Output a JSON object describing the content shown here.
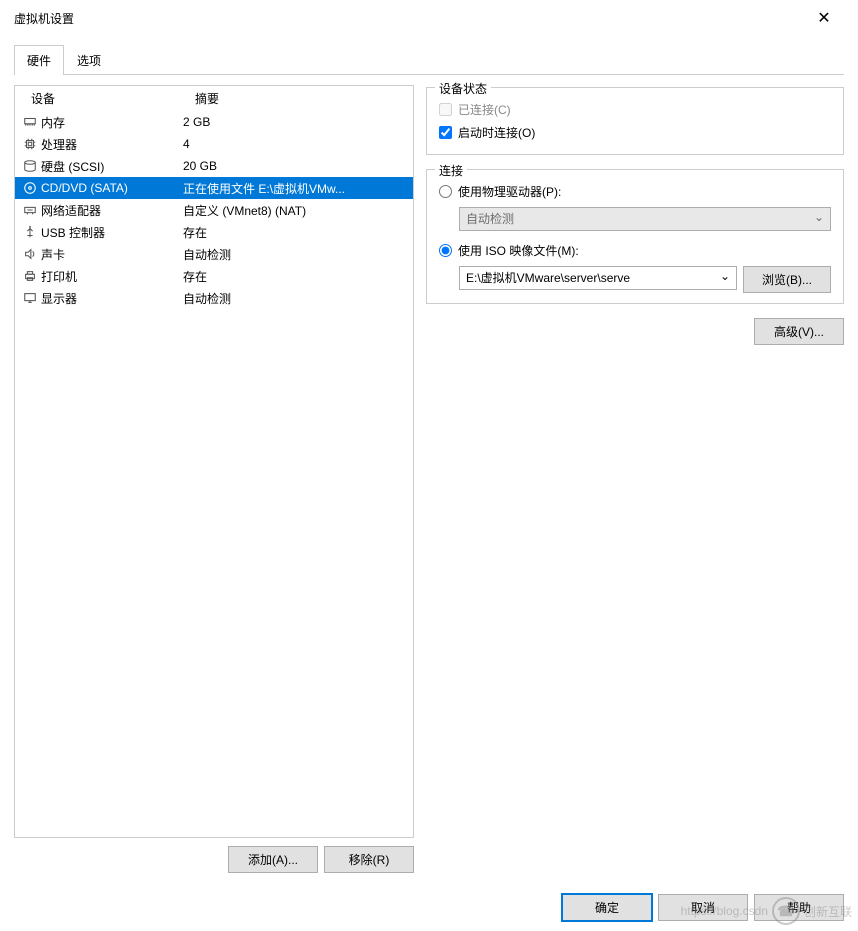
{
  "window": {
    "title": "虚拟机设置"
  },
  "tabs": {
    "hardware": "硬件",
    "options": "选项"
  },
  "hwlist": {
    "header_device": "设备",
    "header_summary": "摘要",
    "rows": [
      {
        "device": "内存",
        "summary": "2 GB",
        "icon": "memory"
      },
      {
        "device": "处理器",
        "summary": "4",
        "icon": "cpu"
      },
      {
        "device": "硬盘 (SCSI)",
        "summary": "20 GB",
        "icon": "disk"
      },
      {
        "device": "CD/DVD (SATA)",
        "summary": "正在使用文件 E:\\虚拟机VMw...",
        "icon": "cd",
        "selected": true
      },
      {
        "device": "网络适配器",
        "summary": "自定义 (VMnet8) (NAT)",
        "icon": "net"
      },
      {
        "device": "USB 控制器",
        "summary": "存在",
        "icon": "usb"
      },
      {
        "device": "声卡",
        "summary": "自动检测",
        "icon": "sound"
      },
      {
        "device": "打印机",
        "summary": "存在",
        "icon": "printer"
      },
      {
        "device": "显示器",
        "summary": "自动检测",
        "icon": "display"
      }
    ],
    "add_btn": "添加(A)...",
    "remove_btn": "移除(R)"
  },
  "status": {
    "group_title": "设备状态",
    "connected": "已连接(C)",
    "connect_at_poweron": "启动时连接(O)"
  },
  "connection": {
    "group_title": "连接",
    "physical": "使用物理驱动器(P):",
    "physical_value": "自动检测",
    "iso": "使用 ISO 映像文件(M):",
    "iso_value": "E:\\虚拟机VMware\\server\\serve",
    "browse": "浏览(B)..."
  },
  "advanced_btn": "高级(V)...",
  "footer": {
    "ok": "确定",
    "cancel": "取消",
    "help": "帮助"
  },
  "watermark": {
    "url": "https://blog.csdn",
    "brand": "创新互联"
  }
}
